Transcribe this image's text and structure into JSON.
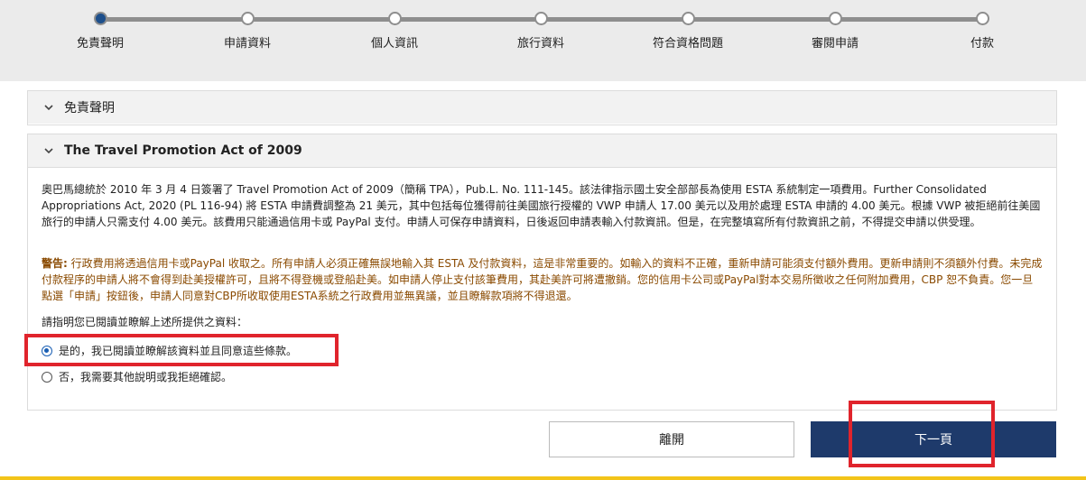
{
  "progress": {
    "steps": [
      {
        "label": "免責聲明",
        "active": true
      },
      {
        "label": "申請資料",
        "active": false
      },
      {
        "label": "個人資訊",
        "active": false
      },
      {
        "label": "旅行資料",
        "active": false
      },
      {
        "label": "符合資格問題",
        "active": false
      },
      {
        "label": "審閱申請",
        "active": false
      },
      {
        "label": "付款",
        "active": false
      }
    ]
  },
  "panels": {
    "disclaimer": {
      "title": "免責聲明",
      "icon": "chevron-down-icon"
    },
    "tpa": {
      "title": "The Travel Promotion Act of 2009",
      "icon": "chevron-down-icon",
      "body": "奧巴馬總統於 2010 年 3 月 4 日簽署了 Travel Promotion Act of 2009（簡稱 TPA），Pub.L. No. 111-145。該法律指示國土安全部部長為使用 ESTA 系統制定一項費用。Further Consolidated Appropriations Act, 2020 (PL 116-94) 將 ESTA 申請費調整為 21 美元，其中包括每位獲得前往美國旅行授權的 VWP 申請人 17.00 美元以及用於處理 ESTA 申請的 4.00 美元。根據 VWP 被拒絕前往美國旅行的申請人只需支付 4.00 美元。該費用只能通過信用卡或 PayPal 支付。申請人可保存申請資料，日後返回申請表輸入付款資訊。但是，在完整填寫所有付款資訊之前，不得提交申請以供受理。",
      "warning_lead": "警告:",
      "warning_text": " 行政費用將透過信用卡或PayPal 收取之。所有申請人必須正確無誤地輸入其 ESTA 及付款資料，這是非常重要的。如輸入的資料不正確，重新申請可能須支付額外費用。更新申請則不須額外付費。未完成付款程序的申請人將不會得到赴美授權許可，且將不得登機或登船赴美。如申請人停止支付該筆費用，其赴美許可將遭撤銷。您的信用卡公司或PayPal對本交易所徵收之任何附加費用，CBP 恕不負責。您一旦點選「申請」按鈕後，申請人同意對CBP所收取使用ESTA系統之行政費用並無異議，並且瞭解款項將不得退還。",
      "question": "請指明您已閱讀並瞭解上述所提供之資料：",
      "options": [
        {
          "label": "是的，我已閱讀並瞭解該資料並且同意這些條款。",
          "checked": true
        },
        {
          "label": "否，我需要其他說明或我拒絕確認。",
          "checked": false
        }
      ]
    }
  },
  "buttons": {
    "leave_label": "離開",
    "next_label": "下一頁"
  },
  "colors": {
    "primary": "#1e3a6b",
    "highlight": "#e0242c",
    "warning_text": "#8a4a00",
    "accent_stripe": "#f3c419"
  }
}
